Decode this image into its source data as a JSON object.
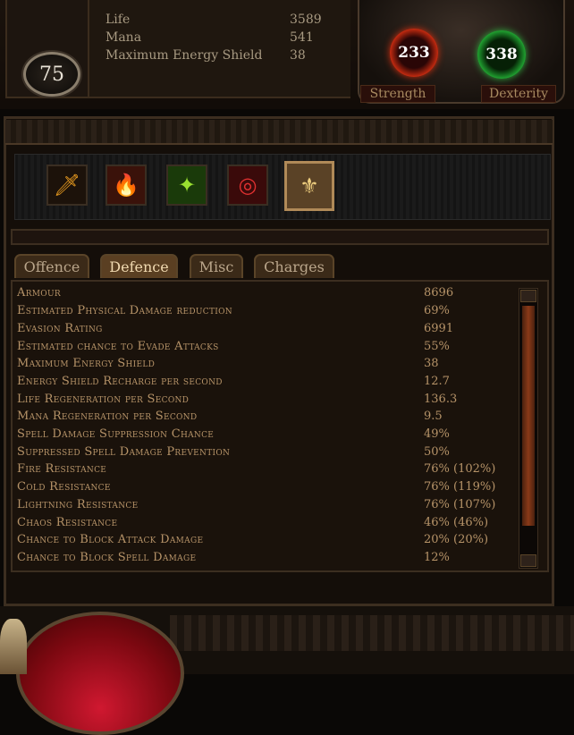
{
  "character": {
    "level": "75",
    "vitals": [
      {
        "label": "Life",
        "value": "3589"
      },
      {
        "label": "Mana",
        "value": "541"
      },
      {
        "label": "Maximum Energy Shield",
        "value": "38"
      }
    ],
    "attributes": {
      "strength": {
        "label": "Strength",
        "value": "233"
      },
      "dexterity": {
        "label": "Dexterity",
        "value": "338"
      }
    }
  },
  "tabs": [
    {
      "label": "Offence"
    },
    {
      "label": "Defence",
      "active": true
    },
    {
      "label": "Misc"
    },
    {
      "label": "Charges"
    }
  ],
  "stats": [
    {
      "name": "Armour",
      "value": "8696"
    },
    {
      "name": "Estimated Physical Damage reduction",
      "value": "69%"
    },
    {
      "name": "Evasion Rating",
      "value": "6991"
    },
    {
      "name": "Estimated chance to Evade Attacks",
      "value": "55%"
    },
    {
      "name": "Maximum Energy Shield",
      "value": "38"
    },
    {
      "name": "Energy Shield Recharge per second",
      "value": "12.7"
    },
    {
      "name": "Life Regeneration per Second",
      "value": "136.3"
    },
    {
      "name": "Mana Regeneration per Second",
      "value": "9.5"
    },
    {
      "name": "Spell Damage Suppression Chance",
      "value": "49%"
    },
    {
      "name": "Suppressed Spell Damage Prevention",
      "value": "50%"
    },
    {
      "name": "Fire Resistance",
      "value": "76% (102%)"
    },
    {
      "name": "Cold Resistance",
      "value": "76% (119%)"
    },
    {
      "name": "Lightning Resistance",
      "value": "76% (107%)"
    },
    {
      "name": "Chaos Resistance",
      "value": "46% (46%)"
    },
    {
      "name": "Chance to Block Attack Damage",
      "value": "20% (20%)"
    },
    {
      "name": "Chance to Block Spell Damage",
      "value": "12%"
    }
  ],
  "skills": [
    {
      "icon": "sword-skill-icon",
      "glyph": "🗡"
    },
    {
      "icon": "fire-skill-icon",
      "glyph": "🔥"
    },
    {
      "icon": "green-aura-skill-icon",
      "glyph": "✦"
    },
    {
      "icon": "red-rune-skill-icon",
      "glyph": "◎"
    },
    {
      "icon": "gold-emblem-skill-icon",
      "glyph": "⚜",
      "active": true
    }
  ],
  "colors": {
    "stat_text": "#b69368",
    "strength_orb": "#c22a10",
    "dexterity_orb": "#20a030"
  }
}
